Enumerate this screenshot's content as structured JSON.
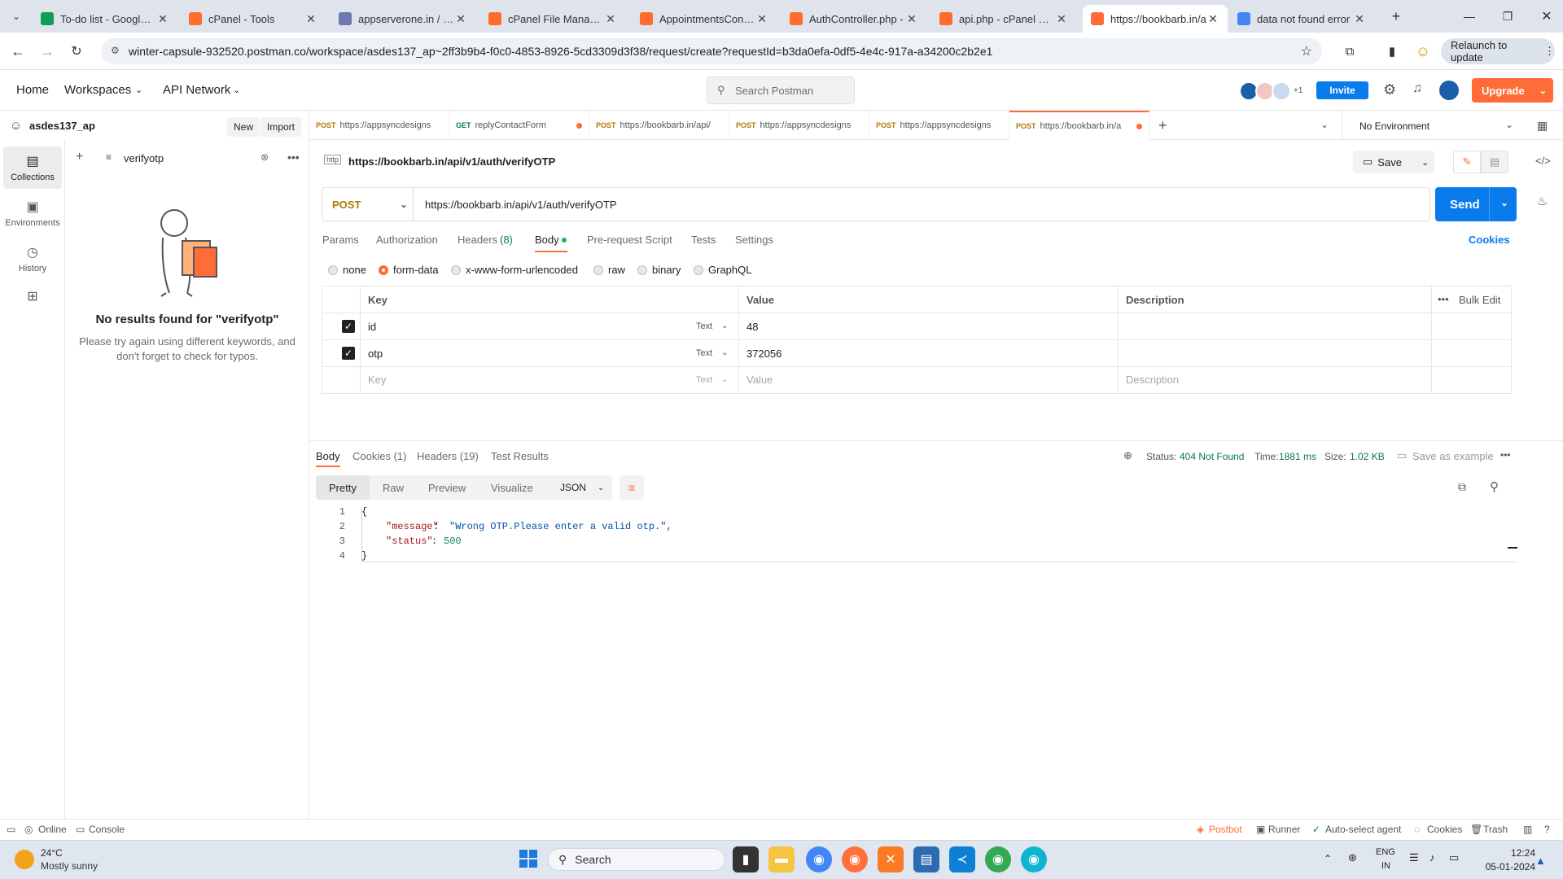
{
  "browser": {
    "tabs": [
      {
        "title": "To-do list - Google Sh",
        "icon": "sheets-icon",
        "color": "#0f9d58"
      },
      {
        "title": "cPanel - Tools",
        "icon": "cpanel-icon",
        "color": "#ff6c2c"
      },
      {
        "title": "appserverone.in / loc",
        "icon": "phpmyadmin-icon",
        "color": "#6c78af"
      },
      {
        "title": "cPanel File Manager v",
        "icon": "cpanel-icon",
        "color": "#ff6c2c"
      },
      {
        "title": "AppointmentsContro",
        "icon": "cpanel-icon",
        "color": "#ff6c2c"
      },
      {
        "title": "AuthController.php -",
        "icon": "cpanel-icon",
        "color": "#ff6c2c"
      },
      {
        "title": "api.php - cPanel File",
        "icon": "cpanel-icon",
        "color": "#ff6c2c"
      },
      {
        "title": "https://bookbarb.in/a",
        "icon": "postman-icon",
        "color": "#ff6c37"
      },
      {
        "title": "data not found error",
        "icon": "google-icon",
        "color": "#4285f4"
      }
    ],
    "url": "winter-capsule-932520.postman.co/workspace/asdes137_ap~2ff3b9b4-f0c0-4853-8926-5cd3309d3f38/request/create?requestId=b3da0efa-0df5-4e4c-917a-a34200c2b2e1",
    "relaunch_label": "Relaunch to update"
  },
  "postman": {
    "nav": {
      "home": "Home",
      "workspaces": "Workspaces",
      "api_network": "API Network"
    },
    "search_placeholder": "Search Postman",
    "invite_label": "Invite",
    "upgrade_label": "Upgrade",
    "avatar_extra": "+1",
    "workspace_name": "asdes137_ap",
    "new_label": "New",
    "import_label": "Import",
    "rail": {
      "collections": "Collections",
      "environments": "Environments",
      "history": "History"
    },
    "filter_value": "verifyotp",
    "empty_title": "No results found for \"verifyotp\"",
    "empty_line1": "Please try again using different keywords, and",
    "empty_line2": "don't forget to check for typos.",
    "request_tabs": [
      {
        "method": "POST",
        "title": "https://appsyncdesigns",
        "dot": false
      },
      {
        "method": "GET",
        "title": "replyContactForm",
        "dot": true
      },
      {
        "method": "POST",
        "title": "https://bookbarb.in/api/",
        "dot": false
      },
      {
        "method": "POST",
        "title": "https://appsyncdesigns",
        "dot": false
      },
      {
        "method": "POST",
        "title": "https://appsyncdesigns",
        "dot": false
      },
      {
        "method": "POST",
        "title": "https://bookbarb.in/a",
        "dot": true
      }
    ],
    "environment": "No Environment",
    "request_title": "https://bookbarb.in/api/v1/auth/verifyOTP",
    "save_label": "Save",
    "method": "POST",
    "request_url": "https://bookbarb.in/api/v1/auth/verifyOTP",
    "send_label": "Send",
    "cookies_label": "Cookies",
    "request_subtabs": {
      "params": "Params",
      "authorization": "Authorization",
      "headers": "Headers",
      "headers_count": "(8)",
      "body": "Body",
      "prerequest": "Pre-request Script",
      "tests": "Tests",
      "settings": "Settings"
    },
    "body_types": [
      "none",
      "form-data",
      "x-www-form-urlencoded",
      "raw",
      "binary",
      "GraphQL"
    ],
    "table": {
      "headers": {
        "key": "Key",
        "value": "Value",
        "description": "Description",
        "bulk_edit": "Bulk Edit"
      },
      "rows": [
        {
          "key": "id",
          "type": "Text",
          "value": "48",
          "description": ""
        },
        {
          "key": "otp",
          "type": "Text",
          "value": "372056",
          "description": ""
        }
      ],
      "placeholder": {
        "key": "Key",
        "type": "Text",
        "value": "Value",
        "description": "Description"
      }
    },
    "response": {
      "tabs": {
        "body": "Body",
        "cookies": "Cookies (1)",
        "headers": "Headers (19)",
        "tests": "Test Results"
      },
      "status_label": "Status:",
      "status_value": "404 Not Found",
      "time_label": "Time:",
      "time_value": "1881 ms",
      "size_label": "Size:",
      "size_value": "1.02 KB",
      "save_example": "Save as example",
      "views": [
        "Pretty",
        "Raw",
        "Preview",
        "Visualize"
      ],
      "format": "JSON",
      "lines": [
        "1",
        "2",
        "3",
        "4"
      ],
      "code": {
        "open": "{",
        "message_key": "\"message\"",
        "message_value": "\"Wrong OTP.Please enter a valid otp.\",",
        "status_key": "\"status\"",
        "status_value": "500",
        "close": "}"
      }
    },
    "statusbar": {
      "online": "Online",
      "console": "Console",
      "postbot": "Postbot",
      "runner": "Runner",
      "autoselect": "Auto-select agent",
      "cookies": "Cookies",
      "trash": "Trash"
    }
  },
  "taskbar": {
    "temp": "24°C",
    "weather": "Mostly sunny",
    "search": "Search",
    "lang1": "ENG",
    "lang2": "IN",
    "time": "12:24",
    "date": "05-01-2024"
  },
  "colors": {
    "accent": "#ff6c37",
    "send": "#097bed",
    "method": "#ad7a03",
    "status_error": "#0b7a4a",
    "json_key": "#a31515",
    "json_string": "#0451a5",
    "json_number": "#098658"
  }
}
